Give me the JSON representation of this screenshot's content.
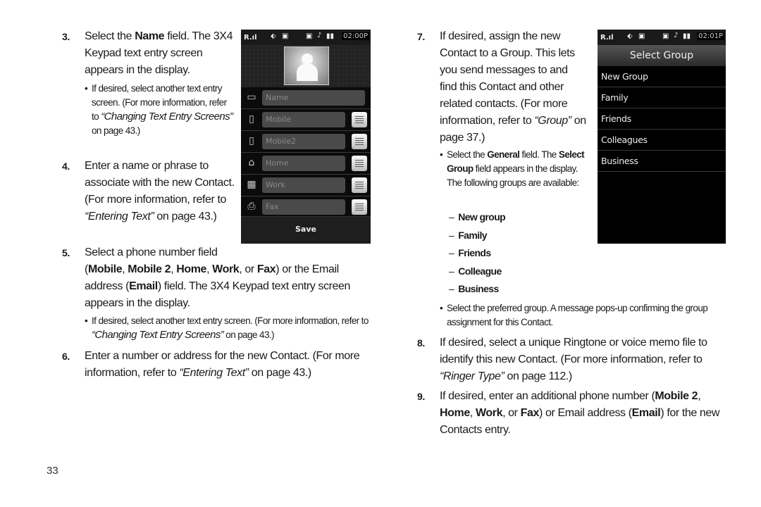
{
  "page_number": "33",
  "left": {
    "step3": {
      "num": "3.",
      "pre": "Select the ",
      "bold": "Name",
      "post": " field. The 3X4 Keypad text entry screen appears in the display."
    },
    "step3_bullet": {
      "pre": "If desired, select another text entry screen. (For more information, refer to ",
      "link": "“Changing Text Entry Screens”",
      "post": " on page 43.)"
    },
    "step4": {
      "num": "4.",
      "pre": "Enter a name or phrase to associate with the new Contact. (For more information, refer to ",
      "link": "“Entering Text”",
      "post": " on page 43.)"
    },
    "step5": {
      "num": "5.",
      "line1": "Select a phone number field",
      "b1": "Mobile",
      "b2": "Mobile 2",
      "b3": "Home",
      "b4": "Work",
      "b5": "Fax",
      "b6": "Email",
      "t_or": ", or ",
      "t_mid": ") or the Email address",
      "t_end": ") field. The 3X4 Keypad text entry screen appears in the display."
    },
    "step5_bullet": {
      "pre": "If desired, select another text entry screen. (For more information, refer to ",
      "link": "“Changing Text Entry Screens”",
      "post": " on page 43.)"
    },
    "step6": {
      "num": "6.",
      "pre": "Enter a number or address for the new Contact. (For more information, refer to ",
      "link": "“Entering Text”",
      "post": " on page 43.)"
    }
  },
  "right": {
    "step7": {
      "num": "7.",
      "pre": "If desired, assign the new Contact to a Group. This lets you send messages to and find this Contact and other related contacts. (For more information, refer to ",
      "link": "“Group”",
      "post": " on page 37.)"
    },
    "step7_bullet": {
      "pre": "Select the ",
      "b1": "General",
      "mid": " field. The ",
      "b2": "Select Group",
      "post": " field appears in the display. The following groups are available:"
    },
    "groups": [
      "New group",
      "Family",
      "Friends",
      "Colleague",
      "Business"
    ],
    "step7_bullet2": "Select the preferred group. A message pops-up confirming the group assignment for this Contact.",
    "step8": {
      "num": "8.",
      "pre": "If desired, select a unique Ringtone or voice memo file to identify this new Contact. (For more information, refer to ",
      "link": "“Ringer Type”",
      "post": " on page 112.)"
    },
    "step9": {
      "num": "9.",
      "pre": "If desired, enter an additional phone number (",
      "b1": "Mobile 2",
      "b2": "Home",
      "b3": "Work",
      "b4": "Fax",
      "b5": "Email",
      "mid": ") or Email address (",
      "post": ") for the new Contacts entry."
    }
  },
  "phone1": {
    "status": {
      "signal": "R.ıl",
      "time": "02:00P"
    },
    "fields": [
      {
        "icon": "contact-card-icon",
        "glyph": "▭",
        "placeholder": "Name",
        "has_button": false
      },
      {
        "icon": "mobile-icon",
        "glyph": "▯",
        "placeholder": "Mobile",
        "has_button": true
      },
      {
        "icon": "mobile-icon",
        "glyph": "▯",
        "placeholder": "Mobile2",
        "has_button": true
      },
      {
        "icon": "home-icon",
        "glyph": "⌂",
        "placeholder": "Home",
        "has_button": true
      },
      {
        "icon": "work-building-icon",
        "glyph": "▦",
        "placeholder": "Work",
        "has_button": true
      },
      {
        "icon": "fax-icon",
        "glyph": "⎙",
        "placeholder": "Fax",
        "has_button": true
      }
    ],
    "save_label": "Save"
  },
  "phone2": {
    "status": {
      "signal": "R.ıl",
      "time": "02:01P"
    },
    "title": "Select Group",
    "items": [
      "New Group",
      "Family",
      "Friends",
      "Colleagues",
      "Business"
    ]
  }
}
